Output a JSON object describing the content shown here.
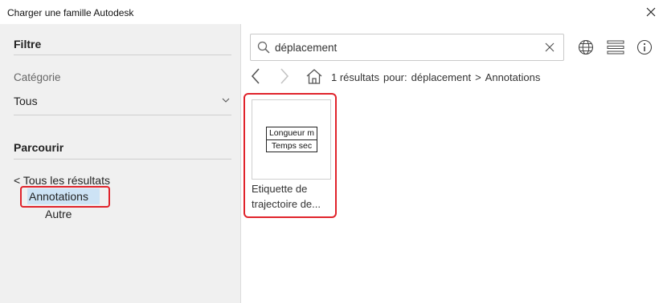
{
  "window": {
    "title": "Charger une famille Autodesk"
  },
  "sidebar": {
    "filter_heading": "Filtre",
    "category_label": "Catégorie",
    "category_value": "Tous",
    "browse_heading": "Parcourir",
    "back_link": "< Tous les résultats",
    "tree": [
      {
        "label": "Annotations",
        "selected": true
      },
      {
        "label": "Autre",
        "selected": false
      }
    ]
  },
  "search": {
    "value": "déplacement"
  },
  "breadcrumb": {
    "count": "1 résultats",
    "for_label": "pour:",
    "query": "déplacement",
    "separator": ">",
    "category": "Annotations"
  },
  "results": [
    {
      "preview_rows": [
        "Longueur m",
        "Temps sec"
      ],
      "label_line1": "Etiquette de",
      "label_line2": "trajectoire de..."
    }
  ],
  "icons": [
    "search-icon",
    "clear-icon",
    "globe-icon",
    "list-view-icon",
    "info-icon",
    "back-icon",
    "forward-icon",
    "home-icon",
    "chevron-down-icon",
    "close-icon"
  ],
  "colors": {
    "highlight_border": "#e0232b",
    "selection_bg": "#cde3f5",
    "sidebar_bg": "#f0f0f0"
  }
}
